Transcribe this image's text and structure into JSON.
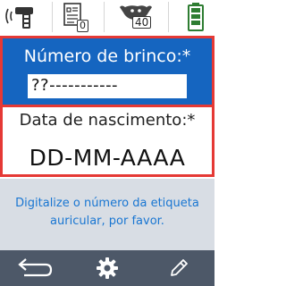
{
  "status_bar": {
    "scanner_icon": "rfid-scanner-icon",
    "device_count": "0",
    "animal_count": "40",
    "battery_icon": "battery-icon",
    "battery_color": "#2e7d32"
  },
  "ear_tag": {
    "label": "Número de brinco:*",
    "value": "??-----------",
    "background": "#1565c0",
    "highlight_border": "#e53935"
  },
  "birth_date": {
    "label": "Data de nascimento:*",
    "value": "DD-MM-AAAA"
  },
  "instruction": {
    "text": "Digitalize o número da etiqueta auricular, por favor."
  },
  "toolbar": {
    "back_icon": "back-arrow-icon",
    "settings_icon": "gear-icon",
    "edit_icon": "pencil-icon"
  }
}
